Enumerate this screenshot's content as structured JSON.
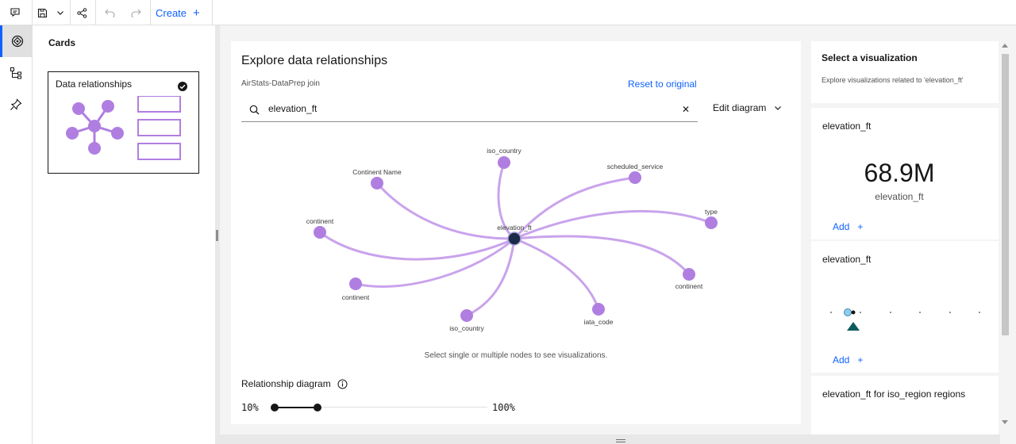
{
  "toolbar": {
    "create_label": "Create",
    "icons": [
      "comment-icon",
      "save-icon",
      "chevron-down-icon",
      "share-icon",
      "undo-icon",
      "redo-icon",
      "add-icon"
    ]
  },
  "rail": {
    "items": [
      "explore-icon",
      "hierarchy-icon",
      "pin-icon"
    ]
  },
  "cards_panel": {
    "title": "Cards",
    "cards": [
      {
        "label": "Data relationships",
        "selected": true
      }
    ]
  },
  "explore": {
    "title": "Explore data relationships",
    "source": "AirStats-DataPrep join",
    "reset_label": "Reset to original",
    "search_value": "elevation_ft",
    "edit_diagram_label": "Edit diagram",
    "hint": "Select single or multiple nodes to see visualizations.",
    "relationship_label": "Relationship diagram",
    "slider": {
      "min_label": "10%",
      "max_label": "100%"
    },
    "graph": {
      "center": "elevation_ft",
      "nodes": [
        "iso_country",
        "scheduled_service",
        "Continent Name",
        "type",
        "continent",
        "continent",
        "continent",
        "iso_country",
        "iata_code"
      ]
    }
  },
  "right_panel": {
    "title": "Select a visualization",
    "subtitle": "Explore visualizations related to 'elevation_ft'",
    "cards": [
      {
        "name": "elevation_ft",
        "kpi_value": "68.9M",
        "kpi_label": "elevation_ft",
        "add_label": "Add"
      },
      {
        "name": "elevation_ft",
        "add_label": "Add"
      },
      {
        "name": "elevation_ft for iso_region regions"
      }
    ]
  },
  "colors": {
    "accent": "#0f62fe",
    "node": "#b07ee0",
    "edge": "#c9a3ec",
    "center_node": "#1b2a4a"
  }
}
